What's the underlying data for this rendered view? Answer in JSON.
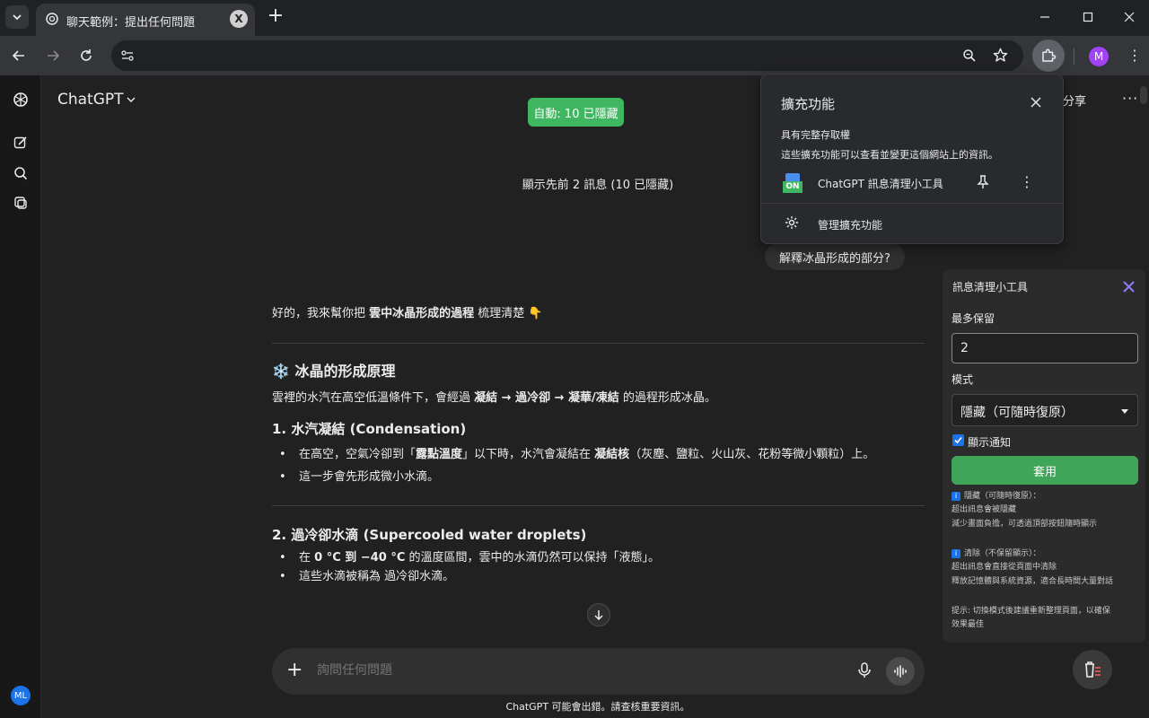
{
  "browser": {
    "tab_title": "聊天範例：提出任何問題",
    "tab_close": "X",
    "profile_initial": "M"
  },
  "app": {
    "model_name": "ChatGPT",
    "auto_badge": "自動: 10 已隱藏",
    "share_label": "分享",
    "more_label": "···",
    "hidden_note": "顯示先前 2 訊息 (10 已隱藏)",
    "user_message": "解釋冰晶形成的部分?",
    "user_avatar": "ML",
    "composer_placeholder": "詢問任何問題",
    "disclaimer": "ChatGPT 可能會出錯。請查核重要資訊。"
  },
  "answer": {
    "intro_prefix": "好的，我來幫你把 ",
    "intro_bold": "雲中冰晶形成的過程",
    "intro_suffix": " 梳理清楚 👇",
    "section_icon": "❄️",
    "section_title": "冰晶的形成原理",
    "section_desc_prefix": "雲裡的水汽在高空低溫條件下，會經過 ",
    "section_desc_bold": "凝結 → 過冷卻 → 凝華/凍結",
    "section_desc_suffix": " 的過程形成冰晶。",
    "step1_title": "1. 水汽凝結 (Condensation)",
    "step1_b1_prefix": "在高空，空氣冷卻到「",
    "step1_b1_bold": "露點溫度",
    "step1_b1_mid": "」以下時，水汽會凝結在 ",
    "step1_b1_bold2": "凝結核",
    "step1_b1_suffix": "（灰塵、鹽粒、火山灰、花粉等微小顆粒）上。",
    "step1_b2": "這一步會先形成微小水滴。",
    "step2_title": "2. 過冷卻水滴 (Supercooled water droplets)",
    "step2_b1_prefix": "在 ",
    "step2_b1_bold": "0 °C 到 −40 °C",
    "step2_b1_suffix": " 的溫度區間，雲中的水滴仍然可以保持「液態」。",
    "step2_b2": "這些水滴被稱為 過冷卻水滴。"
  },
  "extensions_popup": {
    "title": "擴充功能",
    "full_access": "具有完整存取權",
    "access_desc": "這些擴充功能可以查看並變更這個網站上的資訊。",
    "ext_badge": "ON",
    "ext_name": "ChatGPT 訊息清理小工具",
    "ext_more": "⋮",
    "manage": "管理擴充功能"
  },
  "cleaner": {
    "title": "訊息清理小工具",
    "keep_label": "最多保留",
    "keep_value": "2",
    "mode_label": "模式",
    "mode_value": "隱藏（可隨時復原）",
    "notify_label": "顯示通知",
    "apply_label": "套用",
    "help_hide_title": "隱藏（可隨時復原）：",
    "help_hide_l1": "超出訊息會被隱藏",
    "help_hide_l2": "減少畫面負擔，可透過頂部按鈕隨時顯示",
    "help_del_title": "清除（不保留顯示）：",
    "help_del_l1": "超出訊息會直接從頁面中清除",
    "help_del_l2": "釋放記憶體與系統資源，適合長時間大量對話",
    "tip_l1": "提示: 切換模式後建議重新整理頁面，以確保",
    "tip_l2": "效果最佳"
  },
  "colors": {
    "accent_green": "#3fb760",
    "apply_green": "#3fa659",
    "close_purple": "#8a7cf7",
    "profile_purple": "#a142f4"
  }
}
